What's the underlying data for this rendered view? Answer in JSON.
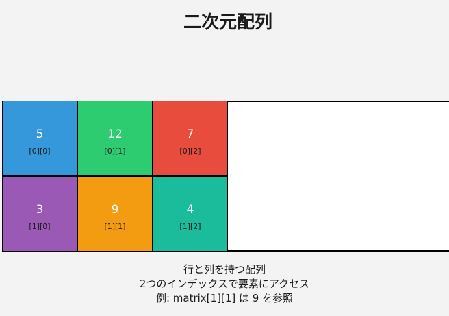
{
  "title": "二次元配列",
  "matrix": {
    "rows": [
      [
        {
          "value": "5",
          "index": "[0][0]",
          "color": "#3498db"
        },
        {
          "value": "12",
          "index": "[0][1]",
          "color": "#2ecc71"
        },
        {
          "value": "7",
          "index": "[0][2]",
          "color": "#e74c3c"
        }
      ],
      [
        {
          "value": "3",
          "index": "[1][0]",
          "color": "#9b59b6"
        },
        {
          "value": "9",
          "index": "[1][1]",
          "color": "#f39c12"
        },
        {
          "value": "4",
          "index": "[1][2]",
          "color": "#1abc9c"
        }
      ]
    ]
  },
  "caption": {
    "line1": "行と列を持つ配列",
    "line2": "2つのインデックスで要素にアクセス",
    "line3": "例: matrix[1][1] は 9 を参照"
  }
}
